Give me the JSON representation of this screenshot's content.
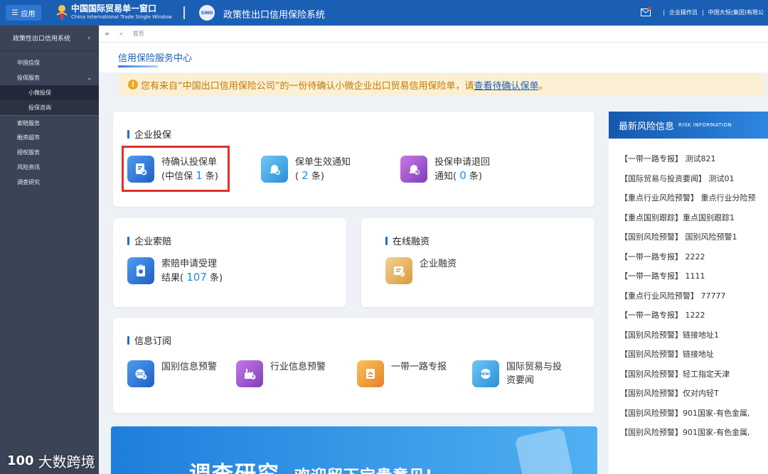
{
  "topbar": {
    "menu_label": "应用",
    "logo_cn": "中国国际贸易单一窗口",
    "logo_en": "China International Trade Single Window",
    "sys_logo_text": "SINO",
    "system_title": "政策性出口信用保险系统",
    "operator_label": "企业操作员",
    "company_label": "中国大恒(集团)有限公",
    "accent": "#1b5fb5"
  },
  "sidebar": {
    "title": "政策性出口信用系统",
    "items": [
      {
        "label": "中国信保"
      },
      {
        "label": "投保服务",
        "children": [
          {
            "label": "小微投保"
          },
          {
            "label": "投保咨询"
          }
        ]
      },
      {
        "label": "索赔服务"
      },
      {
        "label": "融资超市"
      },
      {
        "label": "授权服务"
      },
      {
        "label": "风险资讯"
      },
      {
        "label": "调查研究"
      }
    ]
  },
  "tabs": {
    "current": "首页"
  },
  "page": {
    "title": "信用保险服务中心"
  },
  "notice": {
    "text": "您有来自“中国出口信用保险公司”的一份待确认小微企业出口贸易信用保险单，请",
    "link": "查看待确认保单",
    "end": "。"
  },
  "enterprise_insure": {
    "title": "企业投保",
    "items": [
      {
        "line1": "待确认投保单",
        "line2_pre": "(中信保",
        "count": "1",
        "line2_post": "条)"
      },
      {
        "line1": "保单生效通知",
        "line2_pre": "(",
        "count": "2",
        "line2_post": "条)"
      },
      {
        "line1": "投保申请退回",
        "line2_pre": "通知(",
        "count": "0",
        "line2_post": "条)"
      }
    ]
  },
  "claims": {
    "title": "企业索赔",
    "item": {
      "line1": "索赔申请受理",
      "line2_pre": "结果(",
      "count": "107",
      "line2_post": "条)"
    }
  },
  "financing": {
    "title": "在线融资",
    "item": "企业融资"
  },
  "info_sub": {
    "title": "信息订阅",
    "items": [
      "国别信息预警",
      "行业信息预警",
      "一带一路专报"
    ],
    "last_line1": "国际贸易与投",
    "last_line2": "资要闻",
    "news_icon_text": "NEWS"
  },
  "risk": {
    "title": "最新风险信息",
    "subtitle": "RISK INFORMATION",
    "items": [
      "【一带一路专报】 测试821",
      "【国际贸易与投资要闻】 测试01",
      "【重点行业风险预警】 重点行业分险预",
      "【重点国别跟踪】重点国别跟踪1",
      "【国别风险预警】 国别风险预警1",
      "【一带一路专报】 2222",
      "【一带一路专报】 1111",
      "【重点行业风险预警】 77777",
      "【一带一路专报】 1222",
      "【国别风险预警】链接地址1",
      "【国别风险预警】链接地址",
      "【国别风险预警】轻工指定天津",
      "【国别风险预警】仅对内轻T",
      "【国别风险预警】901国家-有色金属,",
      "【国别风险预警】901国家-有色金属,"
    ]
  },
  "banner": {
    "text": "调查研究",
    "sub": "欢迎留下宝贵意见!"
  },
  "watermark": {
    "logo": "100",
    "text": "大数跨境"
  }
}
